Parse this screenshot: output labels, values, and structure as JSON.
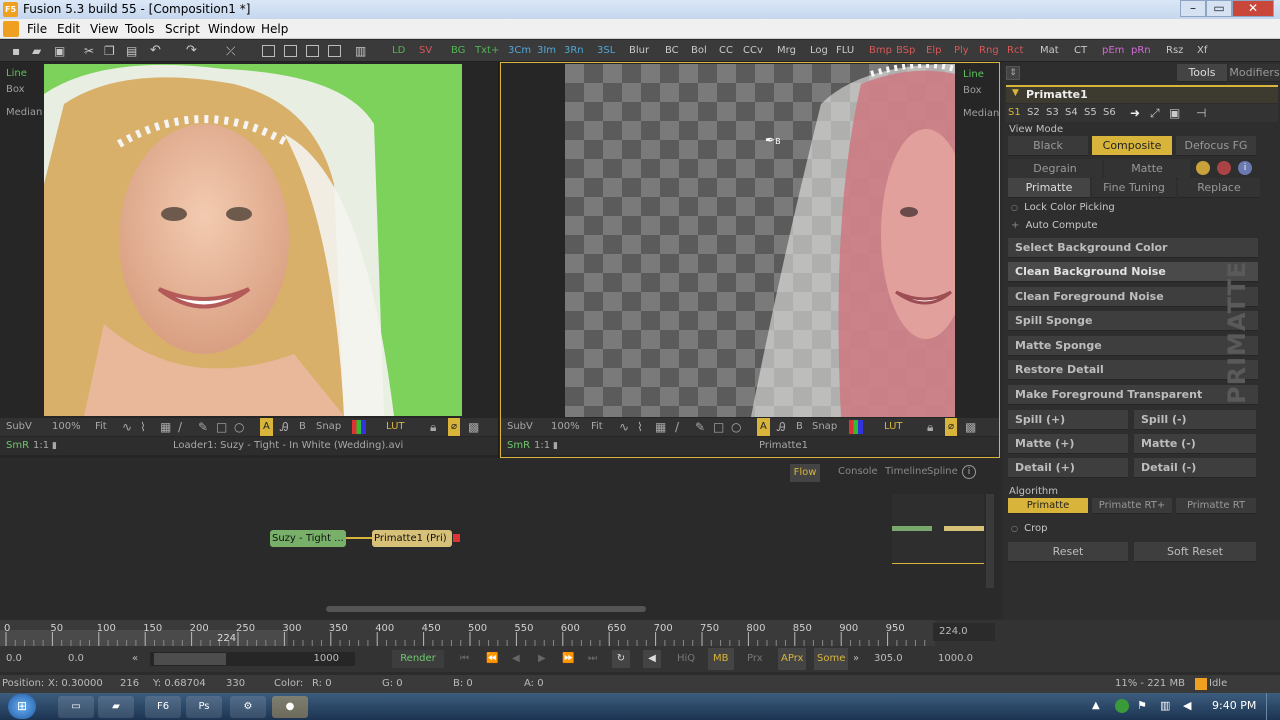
{
  "window": {
    "title": "Fusion 5.3 build 55 - [Composition1 *]",
    "app_icon_text": "F5"
  },
  "menu": [
    "File",
    "Edit",
    "View",
    "Tools",
    "Script",
    "Window",
    "Help"
  ],
  "toolbar": {
    "tools": [
      "LD",
      "SV",
      "BG",
      "Txt+",
      "3Cm",
      "3Im",
      "3Rn",
      "3SL",
      "Blur",
      "BC",
      "Bol",
      "CC",
      "CCv",
      "Mrg",
      "Log",
      "FLU",
      "Bmp",
      "BSp",
      "Elp",
      "Ply",
      "Rng",
      "Rct",
      "Mat",
      "CT",
      "pEm",
      "pRn",
      "Rsz",
      "Xf"
    ]
  },
  "viewer_left": {
    "side": [
      "Line",
      "Box",
      "Median"
    ],
    "bar1": {
      "subv": "SubV",
      "zoom": "100%",
      "fit": "Fit",
      "snap": "Snap",
      "lut": "LUT",
      "a": "A",
      "b": "B"
    },
    "bar2": {
      "smr": "SmR",
      "ratio": "1:1",
      "caption": "Loader1: Suzy - Tight - In White (Wedding).avi"
    }
  },
  "viewer_right": {
    "side": [
      "Line",
      "Box",
      "Median"
    ],
    "bar1": {
      "subv": "SubV",
      "zoom": "100%",
      "fit": "Fit",
      "snap": "Snap",
      "lut": "LUT",
      "a": "A",
      "b": "B"
    },
    "bar2": {
      "smr": "SmR",
      "ratio": "1:1",
      "caption": "Primatte1"
    },
    "picker_label": "B"
  },
  "panel": {
    "tabs": [
      "Tools",
      "Modifiers"
    ],
    "tool_name": "Primatte1",
    "sets": [
      "S1",
      "S2",
      "S3",
      "S4",
      "S5",
      "S6"
    ],
    "view_mode_label": "View Mode",
    "view_modes": [
      "Black",
      "Composite",
      "Defocus FG"
    ],
    "subtabs_top": [
      "Degrain",
      "Matte"
    ],
    "subtabs": [
      "Primatte",
      "Fine Tuning",
      "Replace"
    ],
    "lock_color": "Lock Color Picking",
    "auto_compute": "Auto Compute",
    "ops": [
      "Select Background Color",
      "Clean Background Noise",
      "Clean Foreground Noise",
      "Spill Sponge",
      "Matte Sponge",
      "Restore Detail",
      "Make Foreground Transparent"
    ],
    "pairs": [
      [
        "Spill (+)",
        "Spill (-)"
      ],
      [
        "Matte (+)",
        "Matte (-)"
      ],
      [
        "Detail (+)",
        "Detail (-)"
      ]
    ],
    "algorithm_label": "Algorithm",
    "algorithms": [
      "Primatte",
      "Primatte RT+",
      "Primatte RT"
    ],
    "crop": "Crop",
    "reset": "Reset",
    "soft_reset": "Soft Reset",
    "watermark": "PRIMATTE"
  },
  "flow": {
    "tabs": [
      "Flow",
      "Console",
      "Timeline",
      "Spline"
    ],
    "nodes": [
      {
        "label": "Suzy - Tight ..."
      },
      {
        "label": "Primatte1 (Pri)"
      }
    ]
  },
  "timeline": {
    "ticks": [
      "0",
      "50",
      "100",
      "150",
      "200",
      "250",
      "300",
      "350",
      "400",
      "450",
      "500",
      "550",
      "600",
      "650",
      "700",
      "750",
      "800",
      "850",
      "900",
      "950"
    ],
    "current_marker": "224",
    "current_frame": "224.0",
    "start": "0.0",
    "render_start": "0.0",
    "range_end_label": "1000",
    "render_label": "Render",
    "hiq": "HiQ",
    "mb": "MB",
    "prx": "Prx",
    "aprx": "APrx",
    "some": "Some",
    "end_render": "305.0",
    "end": "1000.0"
  },
  "status": {
    "position_label": "Position:",
    "x": "X: 0.30000",
    "xpx": "216",
    "y": "Y: 0.68704",
    "ypx": "330",
    "color_label": "Color:",
    "r": "R: 0",
    "g": "G: 0",
    "b": "B: 0",
    "a": "A: 0",
    "memory": "11% - 221 MB",
    "state": "Idle"
  },
  "taskbar": {
    "time": "9:40 PM"
  }
}
